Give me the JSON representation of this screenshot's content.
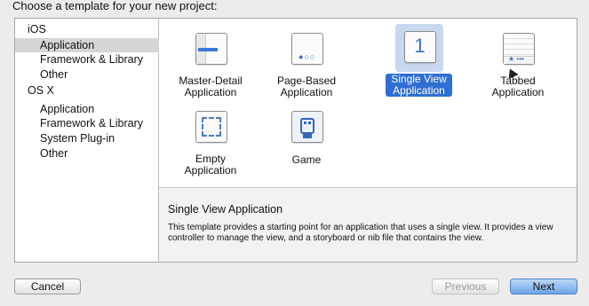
{
  "header": {
    "title": "Choose a template for your new project:"
  },
  "sidebar": {
    "groups": [
      {
        "label": "iOS",
        "items": [
          "Application",
          "Framework & Library",
          "Other"
        ]
      },
      {
        "label": "OS X",
        "items": [
          "Application",
          "Framework & Library",
          "System Plug-in",
          "Other"
        ]
      }
    ],
    "selected": "iOS / Application"
  },
  "templates": [
    {
      "line1": "Master-Detail",
      "line2": "Application",
      "icon": "master-detail-icon",
      "selected": false
    },
    {
      "line1": "Page-Based",
      "line2": "Application",
      "icon": "page-based-icon",
      "selected": false
    },
    {
      "line1": "Single View",
      "line2": "Application",
      "icon": "single-view-icon",
      "selected": true,
      "icon_text": "1"
    },
    {
      "line1": "Tabbed",
      "line2": "Application",
      "icon": "tabbed-icon",
      "selected": false
    },
    {
      "line1": "Empty",
      "line2": "Application",
      "icon": "empty-icon",
      "selected": false
    },
    {
      "line1": "Game",
      "line2": "",
      "icon": "game-icon",
      "selected": false
    }
  ],
  "description": {
    "title": "Single View Application",
    "text": "This template provides a starting point for an application that uses a single view. It provides a view controller to manage the view, and a storyboard or nib file that contains the view."
  },
  "buttons": {
    "cancel": "Cancel",
    "previous": "Previous",
    "next": "Next"
  },
  "colors": {
    "selection_blue": "#2f6fd4",
    "sidebar_selected": "#d6d6d6"
  }
}
